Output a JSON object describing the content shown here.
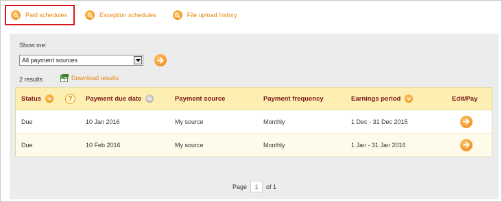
{
  "tabs": [
    {
      "label": "Paid schedules",
      "active": true,
      "icon": "search-icon"
    },
    {
      "label": "Exception schedules",
      "active": false,
      "icon": "search-icon"
    },
    {
      "label": "File upload history",
      "active": false,
      "icon": "search-icon"
    }
  ],
  "filter": {
    "show_me_label": "Show me:",
    "selected_option": "All payment sources"
  },
  "results": {
    "count_text": "2 results",
    "download_label": "Download results"
  },
  "table": {
    "headers": {
      "status": "Status",
      "due_date": "Payment due date",
      "source": "Payment source",
      "frequency": "Payment frequency",
      "earnings": "Earnings period",
      "edit": "Edit/Pay",
      "help": "?"
    },
    "rows": [
      {
        "status": "Due",
        "due_date": "10 Jan 2016",
        "source": "My source",
        "frequency": "Monthly",
        "earnings": "1 Dec - 31 Dec 2015"
      },
      {
        "status": "Due",
        "due_date": "10 Feb 2016",
        "source": "My source",
        "frequency": "Monthly",
        "earnings": "1 Jan - 31 Jan 2016"
      }
    ]
  },
  "pagination": {
    "page_label": "Page",
    "current": "1",
    "of_label": "of 1"
  },
  "colors": {
    "accent": "#e8850a",
    "header_bg": "#fcefb1",
    "header_text": "#7a1418",
    "active_tab_border": "#d6141c"
  }
}
